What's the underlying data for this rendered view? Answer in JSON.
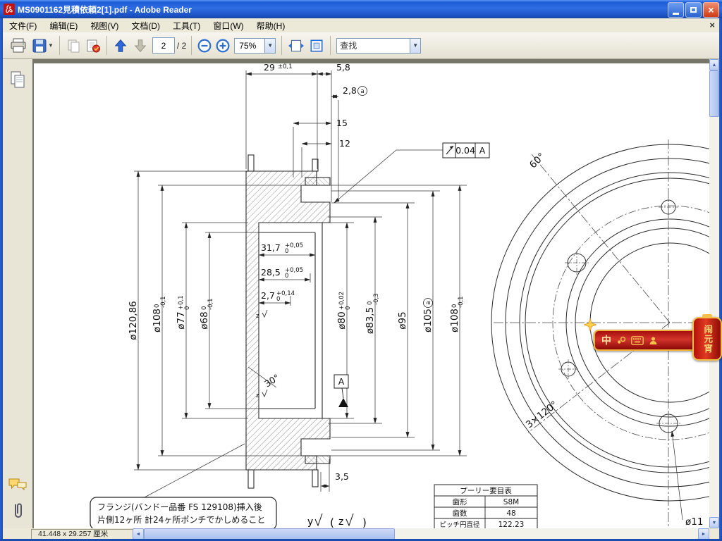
{
  "window": {
    "title": "MS0901162見積依頼2[1].pdf - Adobe Reader",
    "close_glyph": "×"
  },
  "menu": {
    "items": [
      "文件(F)",
      "编辑(E)",
      "视图(V)",
      "文档(D)",
      "工具(T)",
      "窗口(W)",
      "帮助(H)"
    ],
    "doc_close": "×"
  },
  "toolbar": {
    "page": "2",
    "page_total": "/ 2",
    "zoom": "75%",
    "find": "查找"
  },
  "status": {
    "page_size": "41.448 x 29.257 厘米"
  },
  "ime": {
    "mode": "中",
    "lantern": "闹元宵"
  },
  "drawing": {
    "dim_29": {
      "v": "29",
      "tol": "±0,1"
    },
    "dim_58": "5,8",
    "dim_28": {
      "v": "2,8",
      "mark": "a"
    },
    "dim_15": "15",
    "dim_12": "12",
    "frame": {
      "tol": "0.04",
      "datum": "A"
    },
    "dia_12086": "ø120,86",
    "dia_108l": {
      "v": "ø108",
      "up": "0",
      "lo": "-0,1"
    },
    "dia_77": {
      "v": "ø77",
      "up": "+0,1",
      "lo": "0"
    },
    "dia_68": {
      "v": "ø68",
      "up": "0",
      "lo": "-0,1"
    },
    "w_317": {
      "v": "31,7",
      "up": "+0,05",
      "lo": "0"
    },
    "w_285": {
      "v": "28,5",
      "up": "+0,05",
      "lo": "0"
    },
    "w_27": {
      "v": "2,7",
      "up": "+0,14",
      "lo": "0"
    },
    "dia_80": {
      "v": "ø80",
      "up": "+0,02",
      "lo": "0"
    },
    "dia_835": {
      "v": "ø83,5",
      "up": "0",
      "lo": "-0,3"
    },
    "dia_95": "ø95",
    "dia_105": {
      "v": "ø105",
      "mark": "a"
    },
    "dia_108r": {
      "v": "ø108",
      "up": "0",
      "lo": "-0,1"
    },
    "ang_30": "30°",
    "datum_a": "A",
    "dim_35": "3,5",
    "ang_60": "60°",
    "ang_120": "3×120°",
    "dia_11": "ø11",
    "sur_y": "y",
    "sur_z": "z",
    "sur_z2": "z",
    "sur_z3": "z",
    "paren_l": "(",
    "paren_r": ")",
    "note1": "フランジ(バンドー品番 FS 129108)挿入後",
    "note2": "片側12ヶ所 計24ヶ所ポンチでかしめること",
    "table": {
      "title": "プーリー要目表",
      "r1c1": "歯形",
      "r1c2": "S8M",
      "r2c1": "歯数",
      "r2c2": "48",
      "r3c1": "ピッチ円直径",
      "r3c2": "122.23"
    }
  }
}
